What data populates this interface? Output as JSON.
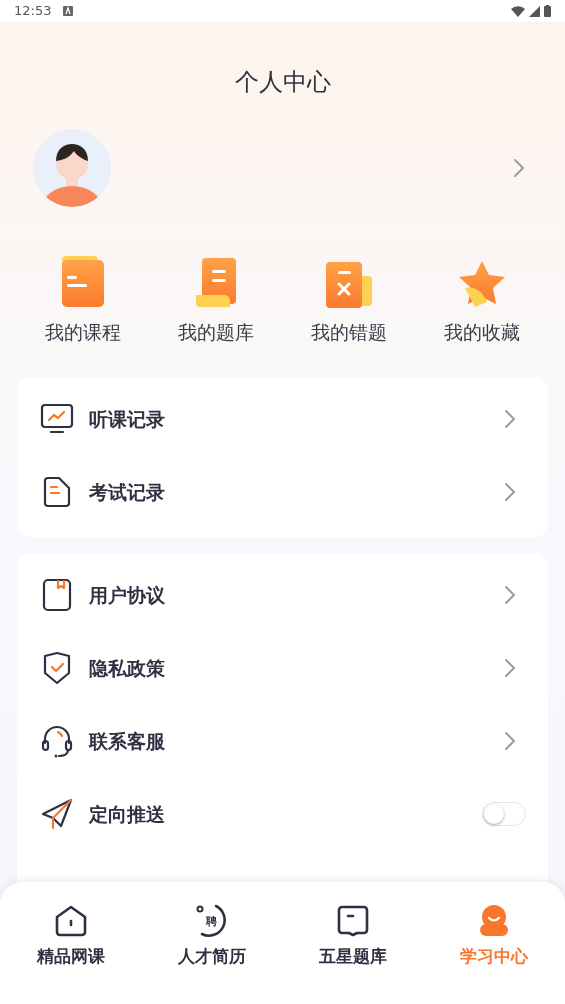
{
  "status_bar": {
    "time": "12:53"
  },
  "title": "个人中心",
  "shortcuts": [
    {
      "label": "我的课程",
      "kind": "folder"
    },
    {
      "label": "我的题库",
      "kind": "scroll"
    },
    {
      "label": "我的错题",
      "kind": "wrong"
    },
    {
      "label": "我的收藏",
      "kind": "star"
    }
  ],
  "menu_groups": [
    [
      {
        "label": "听课记录",
        "kind": "monitor"
      },
      {
        "label": "考试记录",
        "kind": "doc"
      }
    ],
    [
      {
        "label": "用户协议",
        "kind": "book"
      },
      {
        "label": "隐私政策",
        "kind": "shield"
      },
      {
        "label": "联系客服",
        "kind": "headset"
      },
      {
        "label": "定向推送",
        "kind": "send",
        "on": false
      }
    ]
  ],
  "tabs": [
    {
      "label": "精品网课",
      "kind": "home",
      "selected": false
    },
    {
      "label": "人才简历",
      "kind": "resume",
      "icon_glyph": "聘",
      "selected": false
    },
    {
      "label": "五星题库",
      "kind": "bank",
      "selected": false
    },
    {
      "label": "学习中心",
      "kind": "person",
      "selected": true
    }
  ]
}
